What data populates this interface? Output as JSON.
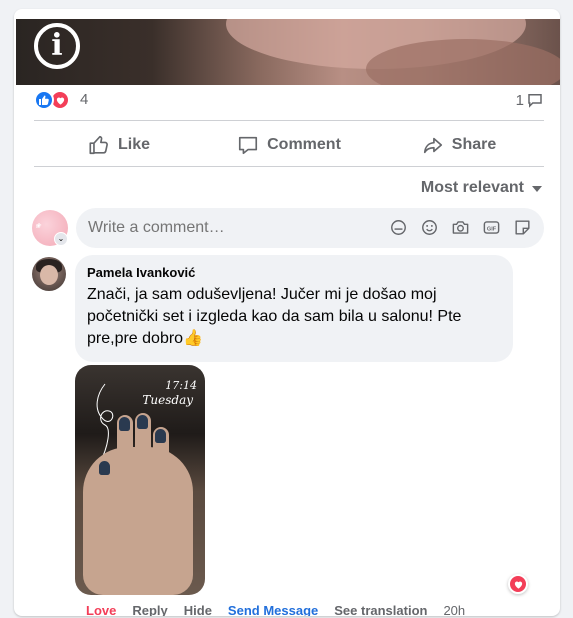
{
  "post": {
    "reaction_count": "4",
    "comment_count": "1",
    "like_label": "Like",
    "comment_label": "Comment",
    "share_label": "Share"
  },
  "comments_header": {
    "sort_label": "Most relevant"
  },
  "composer": {
    "placeholder": "Write a comment…"
  },
  "comment": {
    "author": "Pamela Ivanković",
    "text": "Znači, ja sam oduševljena! Jučer mi je došao moj početnički set i izgleda kao da sam bila u salonu! Pte pre,pre dobro👍",
    "photo_time": "17:14",
    "photo_day": "Tuesday",
    "actions": {
      "love": "Love",
      "reply": "Reply",
      "hide": "Hide",
      "send_message": "Send Message",
      "see_translation": "See translation",
      "time": "20h"
    }
  },
  "colors": {
    "accent_blue": "#1877f2",
    "love_red": "#f33e58",
    "link_blue": "#216fdb"
  }
}
